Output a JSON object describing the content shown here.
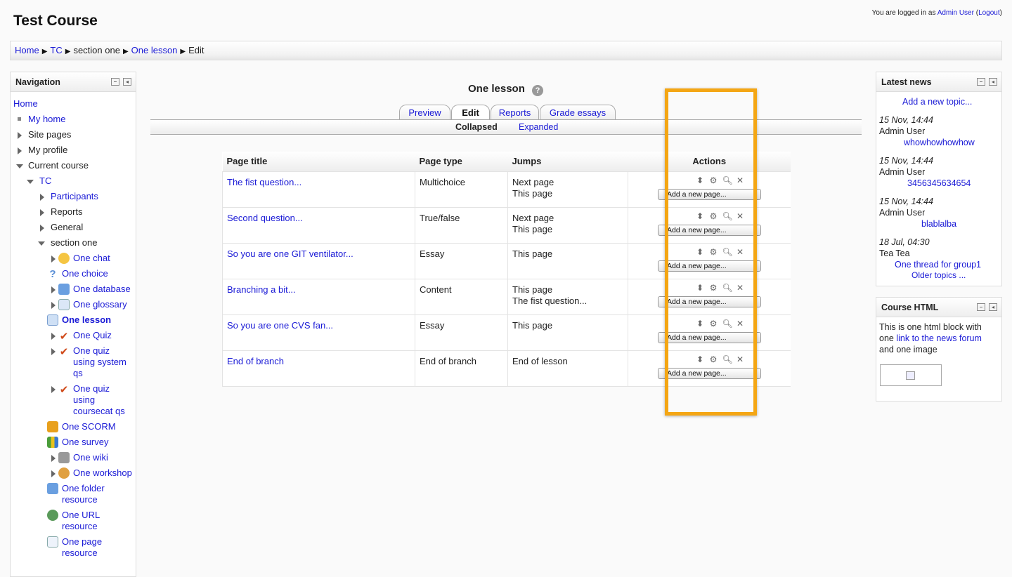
{
  "header": {
    "site_title": "Test Course",
    "login_prefix": "You are logged in as",
    "login_user": "Admin User",
    "logout_label": "Logout"
  },
  "breadcrumb": [
    "Home",
    "TC",
    "section one",
    "One lesson",
    "Edit"
  ],
  "navigation": {
    "title": "Navigation",
    "items": {
      "home": "Home",
      "my_home": "My home",
      "site_pages": "Site pages",
      "my_profile": "My profile",
      "current_course": "Current course",
      "tc": "TC",
      "participants": "Participants",
      "reports": "Reports",
      "general": "General",
      "section_one": "section one",
      "one_chat": "One chat",
      "one_choice": "One choice",
      "one_database": "One database",
      "one_glossary": "One glossary",
      "one_lesson": "One lesson",
      "one_quiz": "One Quiz",
      "one_quiz_system": "One quiz using system qs",
      "one_quiz_coursecat": "One quiz using coursecat qs",
      "one_scorm": "One SCORM",
      "one_survey": "One survey",
      "one_wiki": "One wiki",
      "one_workshop": "One workshop",
      "one_folder": "One folder resource",
      "one_url": "One URL resource",
      "one_page": "One page resource"
    }
  },
  "main": {
    "lesson_title": "One lesson",
    "tabs": [
      "Preview",
      "Edit",
      "Reports",
      "Grade essays"
    ],
    "active_tab": "Edit",
    "subtabs": {
      "collapsed": "Collapsed",
      "expanded": "Expanded"
    },
    "table": {
      "headers": [
        "Page title",
        "Page type",
        "Jumps",
        "Actions"
      ],
      "add_page_label": "Add a new page...",
      "rows": [
        {
          "title": "The fist question...",
          "type": "Multichoice",
          "jump1": "Next page",
          "jump2": "This page"
        },
        {
          "title": "Second question...",
          "type": "True/false",
          "jump1": "Next page",
          "jump2": "This page"
        },
        {
          "title": "So you are one GIT ventilator...",
          "type": "Essay",
          "jump1": "This page",
          "jump2": ""
        },
        {
          "title": "Branching a bit...",
          "type": "Content",
          "jump1": "This page",
          "jump2": "The fist question..."
        },
        {
          "title": "So you are one CVS fan...",
          "type": "Essay",
          "jump1": "This page",
          "jump2": ""
        },
        {
          "title": "End of branch",
          "type": "End of branch",
          "jump1": "End of lesson",
          "jump2": ""
        }
      ]
    }
  },
  "latest_news": {
    "title": "Latest news",
    "add_topic": "Add a new topic...",
    "items": [
      {
        "date": "15 Nov, 14:44",
        "author": "Admin User",
        "subject": "whowhowhowhow"
      },
      {
        "date": "15 Nov, 14:44",
        "author": "Admin User",
        "subject": "3456345634654"
      },
      {
        "date": "15 Nov, 14:44",
        "author": "Admin User",
        "subject": "blablalba"
      },
      {
        "date": "18 Jul, 04:30",
        "author": "Tea Tea",
        "subject": "One thread for group1"
      }
    ],
    "older": "Older topics ..."
  },
  "course_html": {
    "title": "Course HTML",
    "text1": "This is one html block with one",
    "link": "link to the news forum",
    "text2": "and one image"
  },
  "colors": {
    "highlight": "#f4a614",
    "link": "#1a1ad6"
  }
}
